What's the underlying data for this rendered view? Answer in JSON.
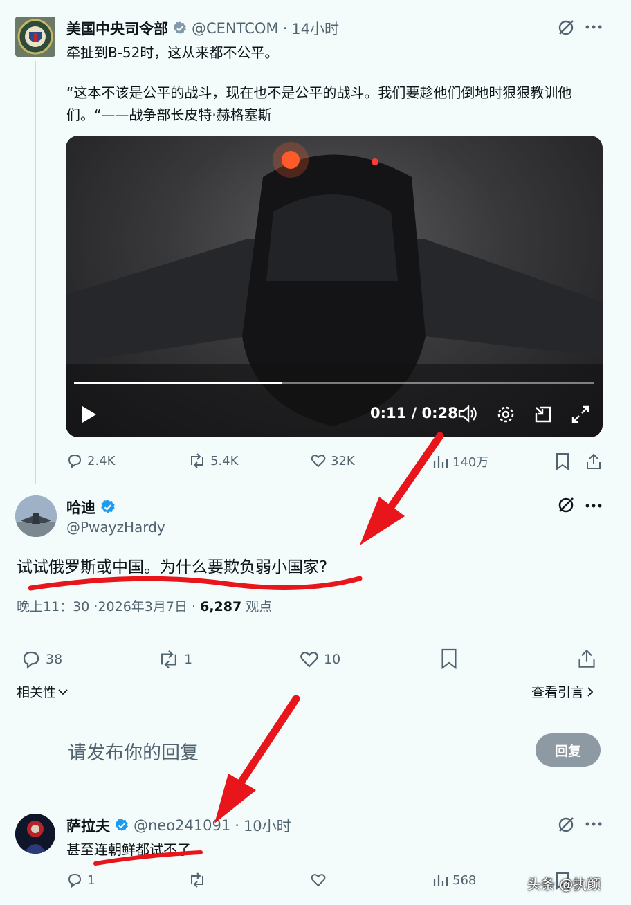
{
  "tweet1": {
    "author_name": "美国中央司令部",
    "handle": "@CENTCOM",
    "separator": "·",
    "time": "14小时",
    "text_line1": "牵扯到B-52时，这从来都不公平。",
    "text_quote": "“这本不该是公平的战斗，现在也不是公平的战斗。我们要趁他们倒地时狠狠教训他们。“——战争部长皮特·赫格塞斯",
    "video": {
      "time": "0:11 / 0:28",
      "progress": 0.4
    },
    "stats": {
      "replies": "2.4K",
      "reposts": "5.4K",
      "likes": "32K",
      "views": "140万"
    }
  },
  "tweet2": {
    "author_name": "哈迪",
    "handle": "@PwayzHardy",
    "text": "试试俄罗斯或中国。为什么要欺负弱小国家?",
    "meta_time": "晚上11：30 ·2026年3月7日 · ",
    "meta_views_count": "6,287",
    "meta_views_label": " 观点",
    "stats": {
      "replies": "38",
      "reposts": "1",
      "likes": "10"
    },
    "sort_label": "相关性",
    "quotes_label": "查看引言"
  },
  "reply_box": {
    "placeholder": "请发布你的回复",
    "button_label": "回复"
  },
  "tweet3": {
    "author_name": "萨拉夫",
    "handle": "@neo241091",
    "separator": "·",
    "time": "10小时",
    "text": "甚至连朝鲜都试不了",
    "stats": {
      "replies": "1",
      "views": "568"
    }
  },
  "watermark": "头条 @执颜",
  "colors": {
    "background": "#f3fbfb",
    "verified": "#1d9bf0",
    "annotation_red": "#e8151b",
    "button_gray": "#8d9aa4"
  },
  "icons": [
    "grok-icon",
    "more-icon",
    "verified-icon",
    "reply-icon",
    "repost-icon",
    "like-icon",
    "views-icon",
    "bookmark-icon",
    "share-icon",
    "play-icon",
    "volume-icon",
    "settings-icon",
    "pip-icon",
    "fullscreen-icon",
    "chevron-down-icon",
    "chevron-right-icon"
  ]
}
